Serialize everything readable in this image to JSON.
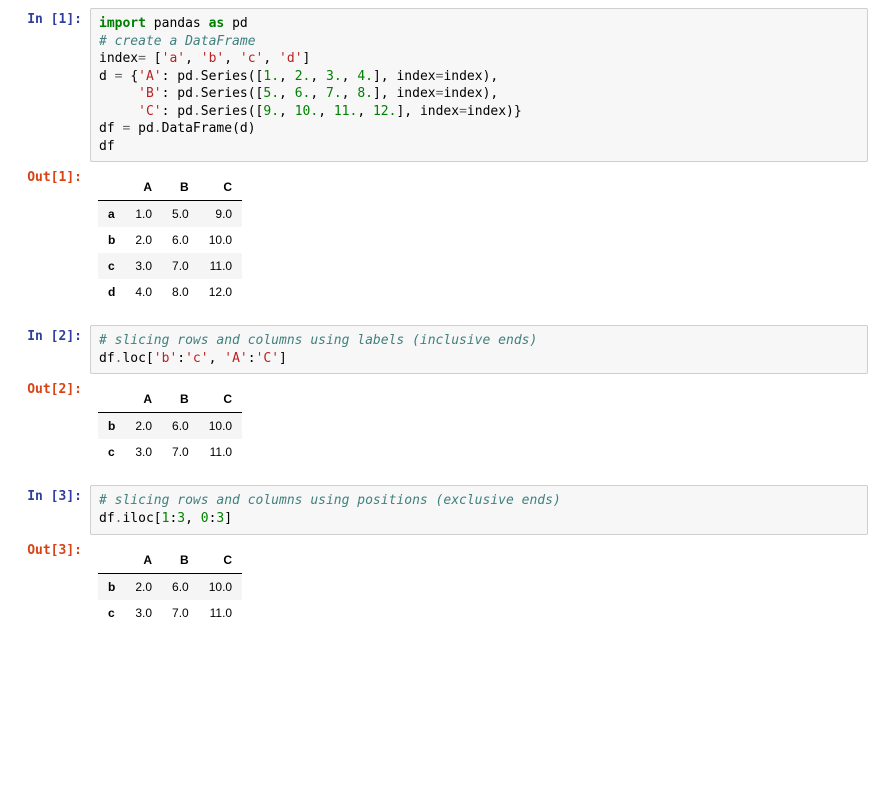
{
  "cells": [
    {
      "in_prompt": "In [1]:",
      "out_prompt": "Out[1]:",
      "code_tokens": [
        {
          "t": "import",
          "c": "kw"
        },
        {
          "t": " pandas ",
          "c": "py"
        },
        {
          "t": "as",
          "c": "kw"
        },
        {
          "t": " pd\n",
          "c": "py"
        },
        {
          "t": "# create a DataFrame\n",
          "c": "cm"
        },
        {
          "t": "index",
          "c": "py"
        },
        {
          "t": "= ",
          "c": "op"
        },
        {
          "t": "[",
          "c": "py"
        },
        {
          "t": "'a'",
          "c": "st"
        },
        {
          "t": ", ",
          "c": "py"
        },
        {
          "t": "'b'",
          "c": "st"
        },
        {
          "t": ", ",
          "c": "py"
        },
        {
          "t": "'c'",
          "c": "st"
        },
        {
          "t": ", ",
          "c": "py"
        },
        {
          "t": "'d'",
          "c": "st"
        },
        {
          "t": "]\n",
          "c": "py"
        },
        {
          "t": "d ",
          "c": "py"
        },
        {
          "t": "= ",
          "c": "op"
        },
        {
          "t": "{",
          "c": "py"
        },
        {
          "t": "'A'",
          "c": "st"
        },
        {
          "t": ": pd",
          "c": "py"
        },
        {
          "t": ".",
          "c": "op"
        },
        {
          "t": "Series([",
          "c": "py"
        },
        {
          "t": "1.",
          "c": "nm"
        },
        {
          "t": ", ",
          "c": "py"
        },
        {
          "t": "2.",
          "c": "nm"
        },
        {
          "t": ", ",
          "c": "py"
        },
        {
          "t": "3.",
          "c": "nm"
        },
        {
          "t": ", ",
          "c": "py"
        },
        {
          "t": "4.",
          "c": "nm"
        },
        {
          "t": "], index",
          "c": "py"
        },
        {
          "t": "=",
          "c": "op"
        },
        {
          "t": "index),\n",
          "c": "py"
        },
        {
          "t": "     ",
          "c": "py"
        },
        {
          "t": "'B'",
          "c": "st"
        },
        {
          "t": ": pd",
          "c": "py"
        },
        {
          "t": ".",
          "c": "op"
        },
        {
          "t": "Series([",
          "c": "py"
        },
        {
          "t": "5.",
          "c": "nm"
        },
        {
          "t": ", ",
          "c": "py"
        },
        {
          "t": "6.",
          "c": "nm"
        },
        {
          "t": ", ",
          "c": "py"
        },
        {
          "t": "7.",
          "c": "nm"
        },
        {
          "t": ", ",
          "c": "py"
        },
        {
          "t": "8.",
          "c": "nm"
        },
        {
          "t": "], index",
          "c": "py"
        },
        {
          "t": "=",
          "c": "op"
        },
        {
          "t": "index),\n",
          "c": "py"
        },
        {
          "t": "     ",
          "c": "py"
        },
        {
          "t": "'C'",
          "c": "st"
        },
        {
          "t": ": pd",
          "c": "py"
        },
        {
          "t": ".",
          "c": "op"
        },
        {
          "t": "Series([",
          "c": "py"
        },
        {
          "t": "9.",
          "c": "nm"
        },
        {
          "t": ", ",
          "c": "py"
        },
        {
          "t": "10.",
          "c": "nm"
        },
        {
          "t": ", ",
          "c": "py"
        },
        {
          "t": "11.",
          "c": "nm"
        },
        {
          "t": ", ",
          "c": "py"
        },
        {
          "t": "12.",
          "c": "nm"
        },
        {
          "t": "], index",
          "c": "py"
        },
        {
          "t": "=",
          "c": "op"
        },
        {
          "t": "index)}\n",
          "c": "py"
        },
        {
          "t": "df ",
          "c": "py"
        },
        {
          "t": "= ",
          "c": "op"
        },
        {
          "t": "pd",
          "c": "py"
        },
        {
          "t": ".",
          "c": "op"
        },
        {
          "t": "DataFrame(d)\n",
          "c": "py"
        },
        {
          "t": "df",
          "c": "py"
        }
      ],
      "output_table": {
        "columns": [
          "A",
          "B",
          "C"
        ],
        "index": [
          "a",
          "b",
          "c",
          "d"
        ],
        "data": [
          [
            "1.0",
            "5.0",
            "9.0"
          ],
          [
            "2.0",
            "6.0",
            "10.0"
          ],
          [
            "3.0",
            "7.0",
            "11.0"
          ],
          [
            "4.0",
            "8.0",
            "12.0"
          ]
        ]
      }
    },
    {
      "in_prompt": "In [2]:",
      "out_prompt": "Out[2]:",
      "code_tokens": [
        {
          "t": "# slicing rows and columns using labels (inclusive ends)\n",
          "c": "cm"
        },
        {
          "t": "df",
          "c": "py"
        },
        {
          "t": ".",
          "c": "op"
        },
        {
          "t": "loc[",
          "c": "py"
        },
        {
          "t": "'b'",
          "c": "st"
        },
        {
          "t": ":",
          "c": "py"
        },
        {
          "t": "'c'",
          "c": "st"
        },
        {
          "t": ", ",
          "c": "py"
        },
        {
          "t": "'A'",
          "c": "st"
        },
        {
          "t": ":",
          "c": "py"
        },
        {
          "t": "'C'",
          "c": "st"
        },
        {
          "t": "]",
          "c": "py"
        }
      ],
      "output_table": {
        "columns": [
          "A",
          "B",
          "C"
        ],
        "index": [
          "b",
          "c"
        ],
        "data": [
          [
            "2.0",
            "6.0",
            "10.0"
          ],
          [
            "3.0",
            "7.0",
            "11.0"
          ]
        ]
      }
    },
    {
      "in_prompt": "In [3]:",
      "out_prompt": "Out[3]:",
      "code_tokens": [
        {
          "t": "# slicing rows and columns using positions (exclusive ends)\n",
          "c": "cm"
        },
        {
          "t": "df",
          "c": "py"
        },
        {
          "t": ".",
          "c": "op"
        },
        {
          "t": "iloc[",
          "c": "py"
        },
        {
          "t": "1",
          "c": "nm"
        },
        {
          "t": ":",
          "c": "py"
        },
        {
          "t": "3",
          "c": "nm"
        },
        {
          "t": ", ",
          "c": "py"
        },
        {
          "t": "0",
          "c": "nm"
        },
        {
          "t": ":",
          "c": "py"
        },
        {
          "t": "3",
          "c": "nm"
        },
        {
          "t": "]",
          "c": "py"
        }
      ],
      "output_table": {
        "columns": [
          "A",
          "B",
          "C"
        ],
        "index": [
          "b",
          "c"
        ],
        "data": [
          [
            "2.0",
            "6.0",
            "10.0"
          ],
          [
            "3.0",
            "7.0",
            "11.0"
          ]
        ]
      }
    }
  ]
}
